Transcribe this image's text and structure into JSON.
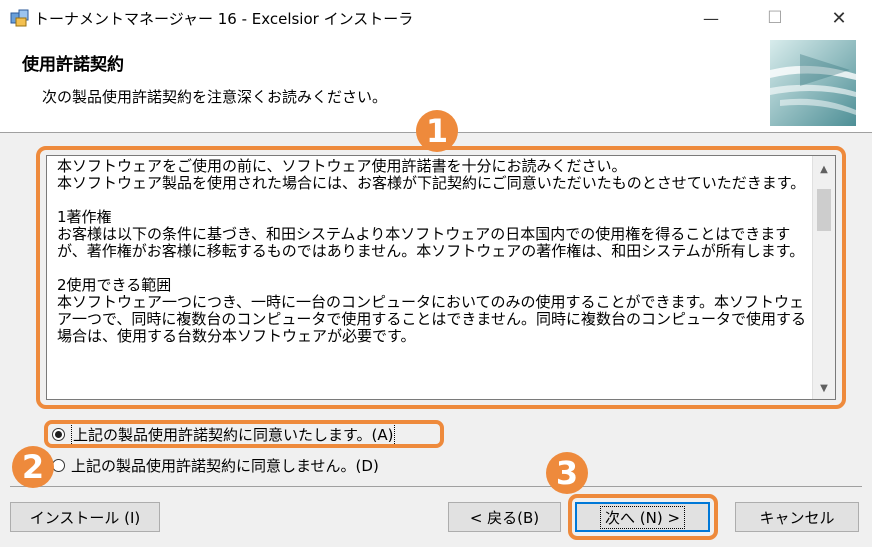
{
  "window": {
    "title": "トーナメントマネージャー 16 - Excelsior インストーラ",
    "minimize_glyph": "—",
    "maximize_glyph": "☐",
    "close_glyph": "✕"
  },
  "header": {
    "title": "使用許諾契約",
    "subtitle": "次の製品使用許諾契約を注意深くお読みください。"
  },
  "license": {
    "text": "本ソフトウェアをご使用の前に、ソフトウェア使用許諾書を十分にお読みください。\n本ソフトウェア製品を使用された場合には、お客様が下記契約にご同意いただいたものとさせていただきます。\n\n1著作権\nお客様は以下の条件に基づき、和田システムより本ソフトウェアの日本国内での使用権を得ることはできますが、著作権がお客様に移転するものではありません。本ソフトウェアの著作権は、和田システムが所有します。\n\n2使用できる範囲\n本ソフトウェア一つにつき、一時に一台のコンピュータにおいてのみの使用することができます。本ソフトウェア一つで、同時に複数台のコンピュータで使用することはできません。同時に複数台のコンピュータで使用する場合は、使用する台数分本ソフトウェアが必要です。",
    "scroll_up": "▲",
    "scroll_down": "▼"
  },
  "options": {
    "agree": "上記の製品使用許諾契約に同意いたします。(A)",
    "disagree": "上記の製品使用許諾契約に同意しません。(D)",
    "selected": "agree"
  },
  "buttons": {
    "install": "インストール (I)",
    "back": "< 戻る(B)",
    "next": "次へ (N) >",
    "cancel": "キャンセル"
  },
  "callouts": [
    "1",
    "2",
    "3"
  ],
  "colors": {
    "highlight": "#ee8a3c",
    "focus": "#0078d7"
  }
}
